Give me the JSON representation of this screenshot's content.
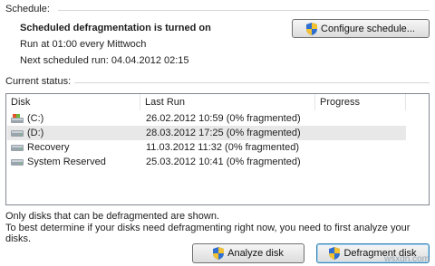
{
  "schedule": {
    "group_label": "Schedule:",
    "status_title": "Scheduled defragmentation is turned on",
    "run_at": "Run at 01:00 every Mittwoch",
    "next_run": "Next scheduled run: 04.04.2012 02:15",
    "configure_button": "Configure schedule..."
  },
  "current_status": {
    "group_label": "Current status:",
    "columns": [
      "Disk",
      "Last Run",
      "Progress"
    ],
    "rows": [
      {
        "disk": "(C:)",
        "last_run": "26.02.2012 10:59 (0% fragmented)",
        "icon": "windows-drive-icon",
        "selected": false
      },
      {
        "disk": "(D:)",
        "last_run": "28.03.2012 17:25 (0% fragmented)",
        "icon": "drive-icon",
        "selected": true
      },
      {
        "disk": "Recovery",
        "last_run": "11.03.2012 11:32 (0% fragmented)",
        "icon": "drive-icon",
        "selected": false
      },
      {
        "disk": "System Reserved",
        "last_run": "25.03.2012 10:41 (0% fragmented)",
        "icon": "drive-icon",
        "selected": false
      }
    ]
  },
  "footer": {
    "info1": "Only disks that can be defragmented are shown.",
    "info2": "To best determine if your disks need defragmenting right now, you need to first analyze your disks.",
    "analyze_button": "Analyze disk",
    "defrag_button": "Defragment disk"
  },
  "watermark": "wsxdn.com"
}
